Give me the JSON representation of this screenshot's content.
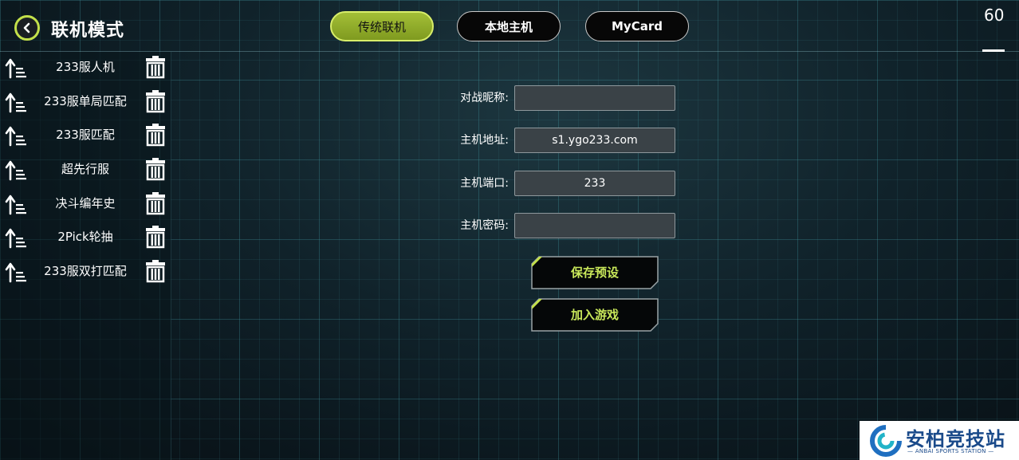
{
  "header": {
    "back_icon": "chevron-left-icon",
    "title": "联机模式",
    "fps": "60"
  },
  "tabs": [
    {
      "label": "传统联机",
      "active": true
    },
    {
      "label": "本地主机",
      "active": false
    },
    {
      "label": "MyCard",
      "active": false
    }
  ],
  "presets": [
    {
      "label": "233服人机"
    },
    {
      "label": "233服单局匹配"
    },
    {
      "label": "233服匹配"
    },
    {
      "label": "超先行服"
    },
    {
      "label": "决斗编年史"
    },
    {
      "label": "2Pick轮抽"
    },
    {
      "label": "233服双打匹配"
    }
  ],
  "form": {
    "nickname": {
      "label": "对战昵称:",
      "value": ""
    },
    "host_address": {
      "label": "主机地址:",
      "value": "s1.ygo233.com"
    },
    "host_port": {
      "label": "主机端口:",
      "value": "233"
    },
    "host_password": {
      "label": "主机密码:",
      "value": ""
    }
  },
  "actions": {
    "save_preset": "保存预设",
    "join_game": "加入游戏"
  },
  "watermark": {
    "title": "安柏竞技站",
    "subtitle": "— ANBAI SPORTS STATION —"
  },
  "colors": {
    "accent": "#c3e04a",
    "active_tab": "#9ab52f",
    "input_bg": "#3a4247"
  }
}
